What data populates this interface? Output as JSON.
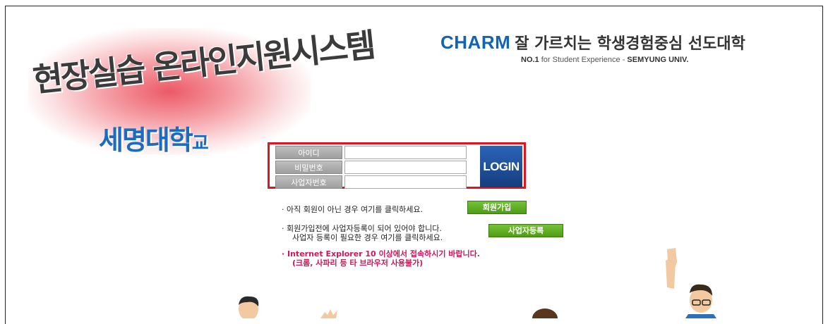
{
  "header": {
    "system_title": "현장실습 온라인지원시스템",
    "university_name": "세명대학",
    "university_suffix": "교",
    "slogan_brand": "CHARM",
    "slogan_text": "잘 가르치는 학생경험중심 선도대학",
    "slogan_sub_prefix": "NO.1",
    "slogan_sub_middle": " for Student Experience - ",
    "slogan_sub_brand": "SEMYUNG UNIV."
  },
  "login": {
    "id_label": "아이디",
    "password_label": "비밀번호",
    "business_label": "사업자번호",
    "id_value": "",
    "password_value": "",
    "business_value": "",
    "login_button": "LOGIN"
  },
  "notices": {
    "signup_text": "· 아직 회원이 아닌 경우 여기를 클릭하세요.",
    "signup_button": "회원가입",
    "register_line1": "· 회원가입전에 사업자등록이 되어 있어야 합니다.",
    "register_line2": "사업자 등록이 필요한 경우 여기를 클릭하세요.",
    "register_button": "사업자등록",
    "browser_line1": "· Internet Explorer 10 이상에서 접속하시기 바랍니다.",
    "browser_line2": "(크롬, 사파리 등 타 브라우저 사용불가)"
  },
  "colors": {
    "brand_blue": "#1464b4",
    "login_border": "#e0141e",
    "warning": "#d4145a",
    "button_green": "#5fae22"
  }
}
